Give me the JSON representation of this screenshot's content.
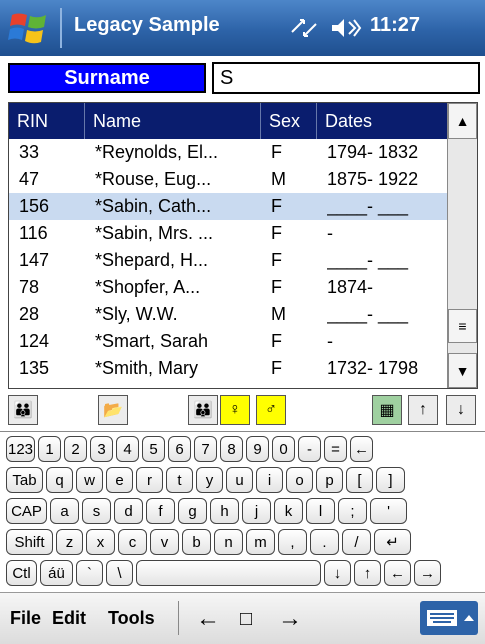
{
  "titlebar": {
    "title": "Legacy Sample",
    "time": "11:27"
  },
  "search": {
    "field_label": "Surname",
    "value": "S"
  },
  "list": {
    "columns": [
      "RIN",
      "Name",
      "Sex",
      "Dates"
    ],
    "rows": [
      {
        "rin": "33",
        "name": "*Reynolds, El...",
        "sex": "F",
        "dates": "1794- 1832"
      },
      {
        "rin": "47",
        "name": "*Rouse, Eug...",
        "sex": "M",
        "dates": "1875- 1922"
      },
      {
        "rin": "156",
        "name": "*Sabin, Cath...",
        "sex": "F",
        "dates": "____- ___"
      },
      {
        "rin": "116",
        "name": "*Sabin, Mrs. ...",
        "sex": "F",
        "dates": "-"
      },
      {
        "rin": "147",
        "name": "*Shepard, H...",
        "sex": "F",
        "dates": "____- ___"
      },
      {
        "rin": "78",
        "name": "*Shopfer, A...",
        "sex": "F",
        "dates": "1874-"
      },
      {
        "rin": "28",
        "name": "*Sly, W.W.",
        "sex": "M",
        "dates": "____- ___"
      },
      {
        "rin": "124",
        "name": "*Smart, Sarah",
        "sex": "F",
        "dates": "-"
      },
      {
        "rin": "135",
        "name": "*Smith, Mary",
        "sex": "F",
        "dates": "1732- 1798"
      }
    ],
    "selected_index": 2
  },
  "keyboard": {
    "row1": [
      "123",
      "1",
      "2",
      "3",
      "4",
      "5",
      "6",
      "7",
      "8",
      "9",
      "0",
      "-",
      "=",
      "←"
    ],
    "row2": [
      "Tab",
      "q",
      "w",
      "e",
      "r",
      "t",
      "y",
      "u",
      "i",
      "o",
      "p",
      "[",
      "]"
    ],
    "row3": [
      "CAP",
      "a",
      "s",
      "d",
      "f",
      "g",
      "h",
      "j",
      "k",
      "l",
      ";",
      "'"
    ],
    "row4": [
      "Shift",
      "z",
      "x",
      "c",
      "v",
      "b",
      "n",
      "m",
      ",",
      ".",
      "/",
      "↵"
    ],
    "row5": [
      "Ctl",
      "áü",
      "`",
      "\\",
      "",
      "↓",
      "↑",
      "←",
      "→"
    ]
  },
  "menubar": {
    "file": "File",
    "edit": "Edit",
    "tools": "Tools"
  }
}
